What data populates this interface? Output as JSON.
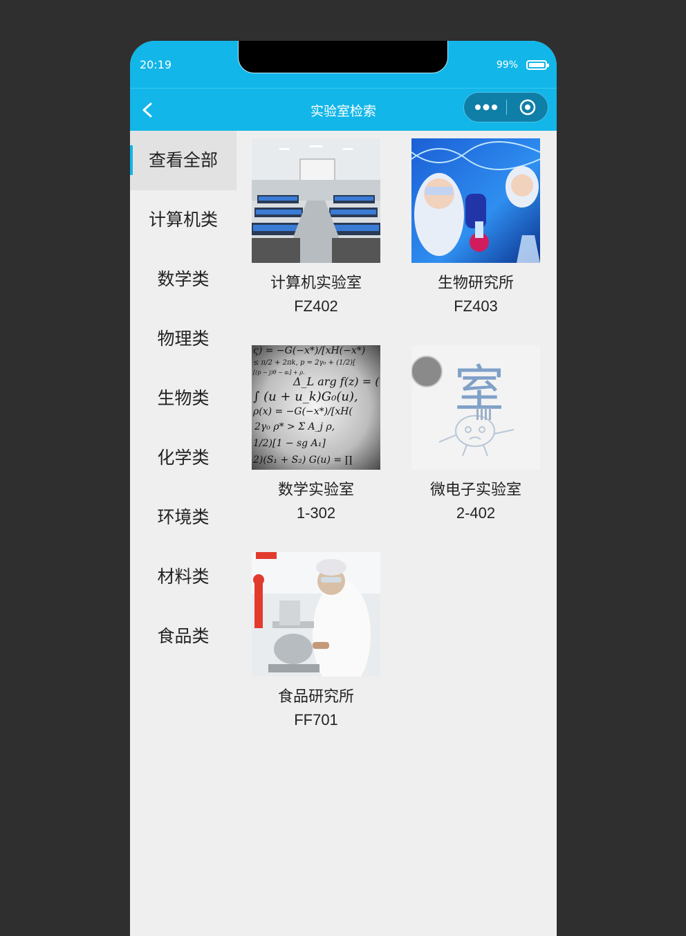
{
  "status": {
    "time": "20:19",
    "battery": "99%",
    "battery_level": 0.99
  },
  "navbar": {
    "title": "实验室检索"
  },
  "colors": {
    "accent": "#12b6e8",
    "background": "#efefef"
  },
  "sidebar": {
    "items": [
      {
        "label": "查看全部",
        "active": true
      },
      {
        "label": "计算机类"
      },
      {
        "label": "数学类"
      },
      {
        "label": "物理类"
      },
      {
        "label": "生物类"
      },
      {
        "label": "化学类"
      },
      {
        "label": "环境类"
      },
      {
        "label": "材料类"
      },
      {
        "label": "食品类"
      }
    ]
  },
  "labs": [
    {
      "name": "计算机实验室",
      "code": "FZ402",
      "image": "computer-lab-photo"
    },
    {
      "name": "生物研究所",
      "code": "FZ403",
      "image": "biology-research-photo"
    },
    {
      "name": "数学实验室",
      "code": "1-302",
      "image": "math-formulas-photo"
    },
    {
      "name": "微电子实验室",
      "code": "2-402",
      "image": "placeholder-image"
    },
    {
      "name": "食品研究所",
      "code": "FF701",
      "image": "food-research-photo"
    }
  ],
  "placeholder_glyph": "室"
}
